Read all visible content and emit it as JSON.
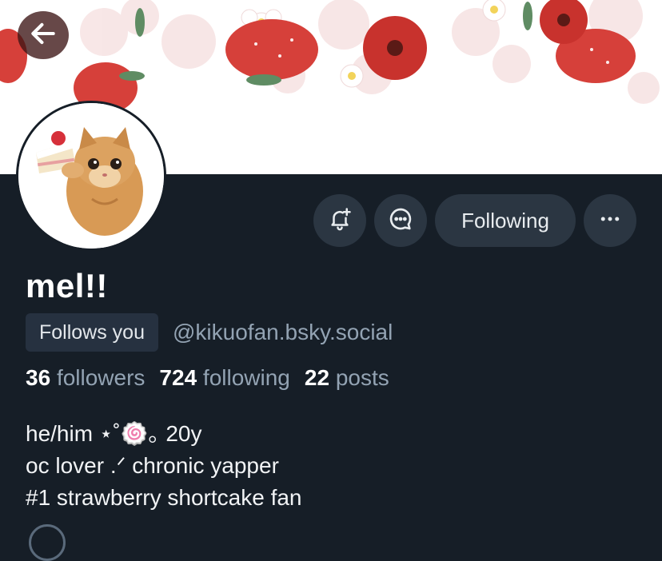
{
  "header": {
    "back_icon": "arrow-left-icon",
    "banner_theme": "strawberries-and-flowers",
    "accent_color": "#c8322d"
  },
  "profile": {
    "display_name": "mel!!",
    "follows_you_label": "Follows you",
    "handle": "@kikuofan.bsky.social",
    "avatar_subject": "cat-with-strawberry-cake"
  },
  "actions": {
    "subscribe_icon": "bell-plus-icon",
    "message_icon": "chat-bubble-icon",
    "following_label": "Following",
    "more_icon": "ellipsis-icon"
  },
  "stats": {
    "followers_count": "36",
    "followers_label": "followers",
    "following_count": "724",
    "following_label": "following",
    "posts_count": "22",
    "posts_label": "posts"
  },
  "bio": {
    "lines": [
      "he/him ⋆˚🍥｡ 20y",
      "oc lover .ᐟ chronic yapper",
      "#1 strawberry shortcake fan"
    ]
  },
  "colors": {
    "background": "#161e27",
    "button_bg": "#2b3642",
    "muted_text": "#93a3b3"
  }
}
